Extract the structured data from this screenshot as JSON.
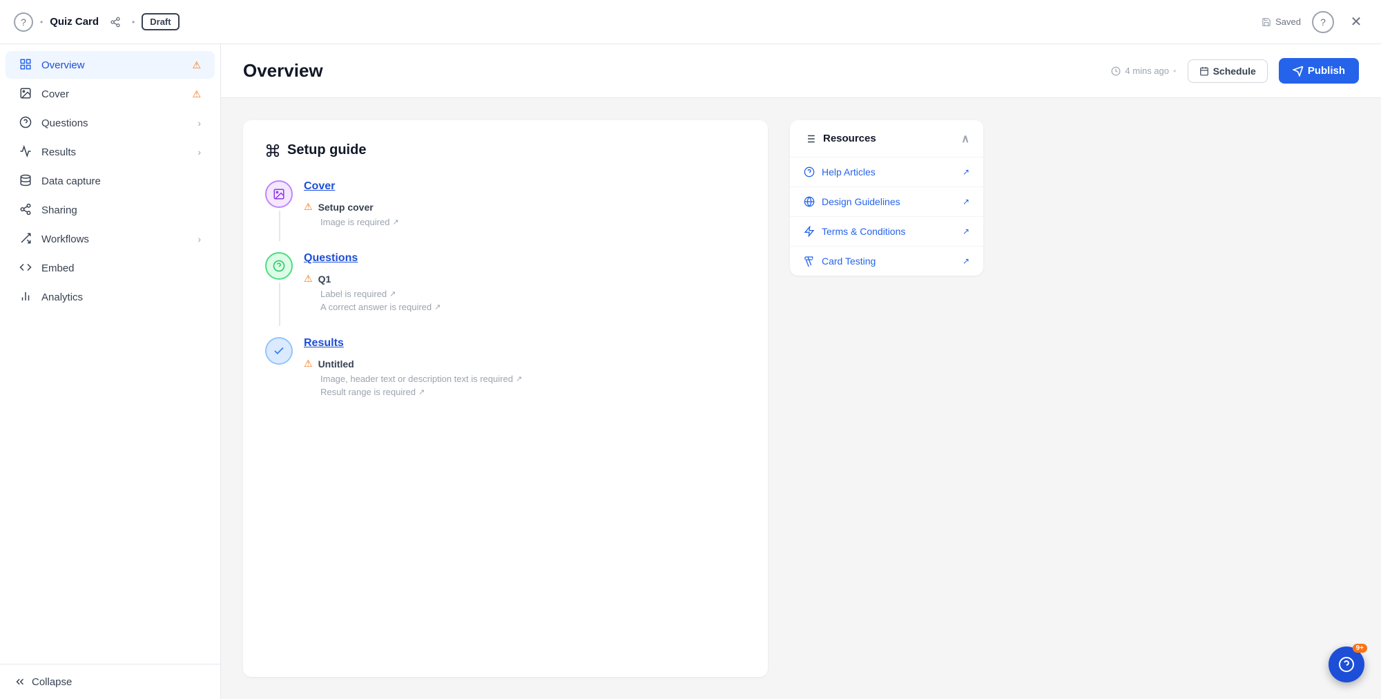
{
  "topbar": {
    "help_icon": "?",
    "title": "Quiz Card",
    "dot": "•",
    "draft_label": "Draft",
    "saved_label": "Saved",
    "close_icon": "✕"
  },
  "sidebar": {
    "items": [
      {
        "id": "overview",
        "label": "Overview",
        "icon": "overview",
        "active": true,
        "warning": false,
        "chevron": false
      },
      {
        "id": "cover",
        "label": "Cover",
        "icon": "cover",
        "active": false,
        "warning": true,
        "chevron": false
      },
      {
        "id": "questions",
        "label": "Questions",
        "icon": "questions",
        "active": false,
        "warning": false,
        "chevron": true
      },
      {
        "id": "results",
        "label": "Results",
        "icon": "results",
        "active": false,
        "warning": false,
        "chevron": true
      },
      {
        "id": "data-capture",
        "label": "Data capture",
        "icon": "data-capture",
        "active": false,
        "warning": false,
        "chevron": false
      },
      {
        "id": "sharing",
        "label": "Sharing",
        "icon": "sharing",
        "active": false,
        "warning": false,
        "chevron": false
      },
      {
        "id": "workflows",
        "label": "Workflows",
        "icon": "workflows",
        "active": false,
        "warning": false,
        "chevron": true
      },
      {
        "id": "embed",
        "label": "Embed",
        "icon": "embed",
        "active": false,
        "warning": false,
        "chevron": false
      },
      {
        "id": "analytics",
        "label": "Analytics",
        "icon": "analytics",
        "active": false,
        "warning": false,
        "chevron": false
      }
    ],
    "collapse_label": "Collapse"
  },
  "content": {
    "title": "Overview",
    "time_ago": "4 mins ago",
    "schedule_label": "Schedule",
    "publish_label": "Publish"
  },
  "setup_guide": {
    "title": "Setup guide",
    "sections": [
      {
        "id": "cover",
        "name": "Cover",
        "icon_type": "cover",
        "icon_emoji": "🖼",
        "sub_items": [
          {
            "title": "Setup cover",
            "warning": true,
            "requirements": [
              {
                "text": "Image is required",
                "link": true
              }
            ]
          }
        ]
      },
      {
        "id": "questions",
        "name": "Questions",
        "icon_type": "questions",
        "icon_emoji": "❓",
        "sub_items": [
          {
            "title": "Q1",
            "warning": true,
            "requirements": [
              {
                "text": "Label is required",
                "link": true
              },
              {
                "text": "A correct answer is required",
                "link": true
              }
            ]
          }
        ]
      },
      {
        "id": "results",
        "name": "Results",
        "icon_type": "results",
        "icon_emoji": "✓",
        "sub_items": [
          {
            "title": "Untitled",
            "warning": true,
            "requirements": [
              {
                "text": "Image, header text or description text is required",
                "link": true
              },
              {
                "text": "Result range is required",
                "link": true
              }
            ]
          }
        ]
      }
    ]
  },
  "resources": {
    "title": "Resources",
    "items": [
      {
        "id": "help-articles",
        "label": "Help Articles",
        "icon": "help-circle"
      },
      {
        "id": "design-guidelines",
        "label": "Design Guidelines",
        "icon": "globe"
      },
      {
        "id": "terms-conditions",
        "label": "Terms & Conditions",
        "icon": "zap"
      },
      {
        "id": "card-testing",
        "label": "Card Testing",
        "icon": "flask"
      }
    ]
  },
  "float_button": {
    "badge": "9+"
  }
}
